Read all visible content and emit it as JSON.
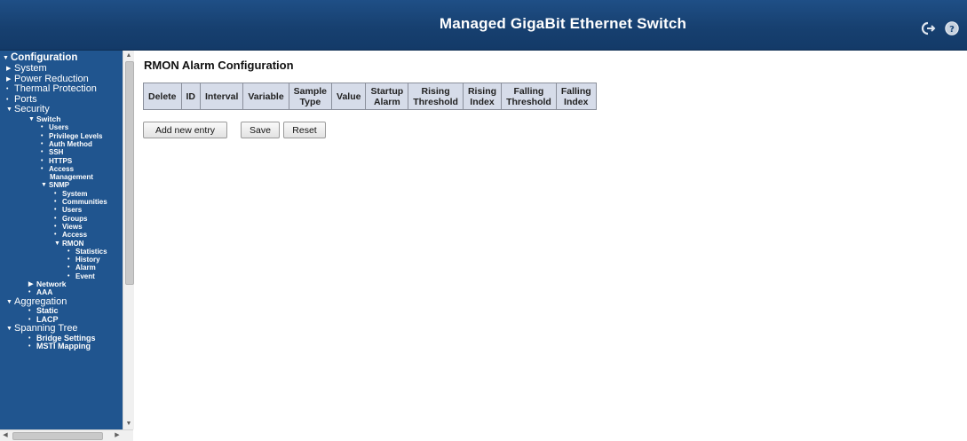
{
  "header": {
    "title": "Managed GigaBit Ethernet Switch",
    "icons": [
      "logout-icon",
      "help-icon"
    ]
  },
  "sidebar": {
    "items": [
      {
        "label": "Configuration",
        "level": 0,
        "marker": "▼",
        "bold": true
      },
      {
        "label": "System",
        "level": 1,
        "marker": "▶"
      },
      {
        "label": "Power Reduction",
        "level": 1,
        "marker": "▶"
      },
      {
        "label": "Thermal Protection",
        "level": 1,
        "marker": "•"
      },
      {
        "label": "Ports",
        "level": 1,
        "marker": "•"
      },
      {
        "label": "Security",
        "level": 1,
        "marker": "▼"
      },
      {
        "label": "Switch",
        "level": 2,
        "marker": "▼"
      },
      {
        "label": "Users",
        "level": 3,
        "marker": "•"
      },
      {
        "label": "Privilege Levels",
        "level": 3,
        "marker": "•"
      },
      {
        "label": "Auth Method",
        "level": 3,
        "marker": "•"
      },
      {
        "label": "SSH",
        "level": 3,
        "marker": "•"
      },
      {
        "label": "HTTPS",
        "level": 3,
        "marker": "•"
      },
      {
        "label": "Access",
        "level": 3,
        "marker": "•"
      },
      {
        "label": "Management",
        "level": 3,
        "marker": ""
      },
      {
        "label": "SNMP",
        "level": 3,
        "marker": "▼"
      },
      {
        "label": "System",
        "level": 4,
        "marker": "•"
      },
      {
        "label": "Communities",
        "level": 4,
        "marker": "•"
      },
      {
        "label": "Users",
        "level": 4,
        "marker": "•"
      },
      {
        "label": "Groups",
        "level": 4,
        "marker": "•"
      },
      {
        "label": "Views",
        "level": 4,
        "marker": "•"
      },
      {
        "label": "Access",
        "level": 4,
        "marker": "•"
      },
      {
        "label": "RMON",
        "level": 4,
        "marker": "▼"
      },
      {
        "label": "Statistics",
        "level": 5,
        "marker": "•"
      },
      {
        "label": "History",
        "level": 5,
        "marker": "•"
      },
      {
        "label": "Alarm",
        "level": 5,
        "marker": "•"
      },
      {
        "label": "Event",
        "level": 5,
        "marker": "•"
      },
      {
        "label": "Network",
        "level": 2,
        "marker": "▶"
      },
      {
        "label": "AAA",
        "level": 2,
        "marker": "•"
      },
      {
        "label": "Aggregation",
        "level": 1,
        "marker": "▼"
      },
      {
        "label": "Static",
        "level": 2,
        "marker": "•"
      },
      {
        "label": "LACP",
        "level": 2,
        "marker": "•"
      },
      {
        "label": "Spanning Tree",
        "level": 1,
        "marker": "▼"
      },
      {
        "label": "Bridge Settings",
        "level": 2,
        "marker": "•"
      },
      {
        "label": "MSTI Mapping",
        "level": 2,
        "marker": "•"
      }
    ]
  },
  "main": {
    "title": "RMON Alarm Configuration",
    "table": {
      "columns": [
        [
          "Delete"
        ],
        [
          "ID"
        ],
        [
          "Interval"
        ],
        [
          "Variable"
        ],
        [
          "Sample",
          "Type"
        ],
        [
          "Value"
        ],
        [
          "Startup",
          "Alarm"
        ],
        [
          "Rising",
          "Threshold"
        ],
        [
          "Rising",
          "Index"
        ],
        [
          "Falling",
          "Threshold"
        ],
        [
          "Falling",
          "Index"
        ]
      ],
      "rows": []
    },
    "buttons": {
      "add_new_entry": "Add new entry",
      "save": "Save",
      "reset": "Reset"
    }
  }
}
